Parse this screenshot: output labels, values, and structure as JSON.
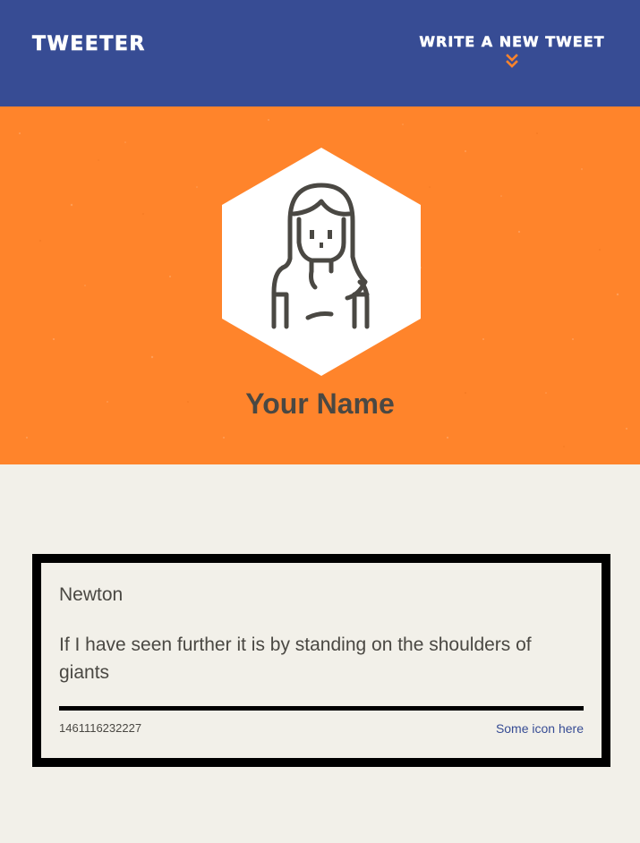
{
  "nav": {
    "brand": "Tweeter",
    "compose_label": "Write a new tweet",
    "compose_icon": "double-chevron-down-icon"
  },
  "profile": {
    "name": "Your Name",
    "avatar_icon": "user-avatar-icon"
  },
  "tweets": [
    {
      "author": "Newton",
      "text": "If I have seen further it is by standing on the shoulders of giants",
      "created_at": "1461116232227",
      "actions_label": "Some icon here"
    }
  ],
  "colors": {
    "nav_bg": "#374c94",
    "profile_bg": "#ff842b",
    "page_bg": "#f2f0e9",
    "text": "#4a4843",
    "accent": "#ff842b",
    "link": "#374c94"
  }
}
